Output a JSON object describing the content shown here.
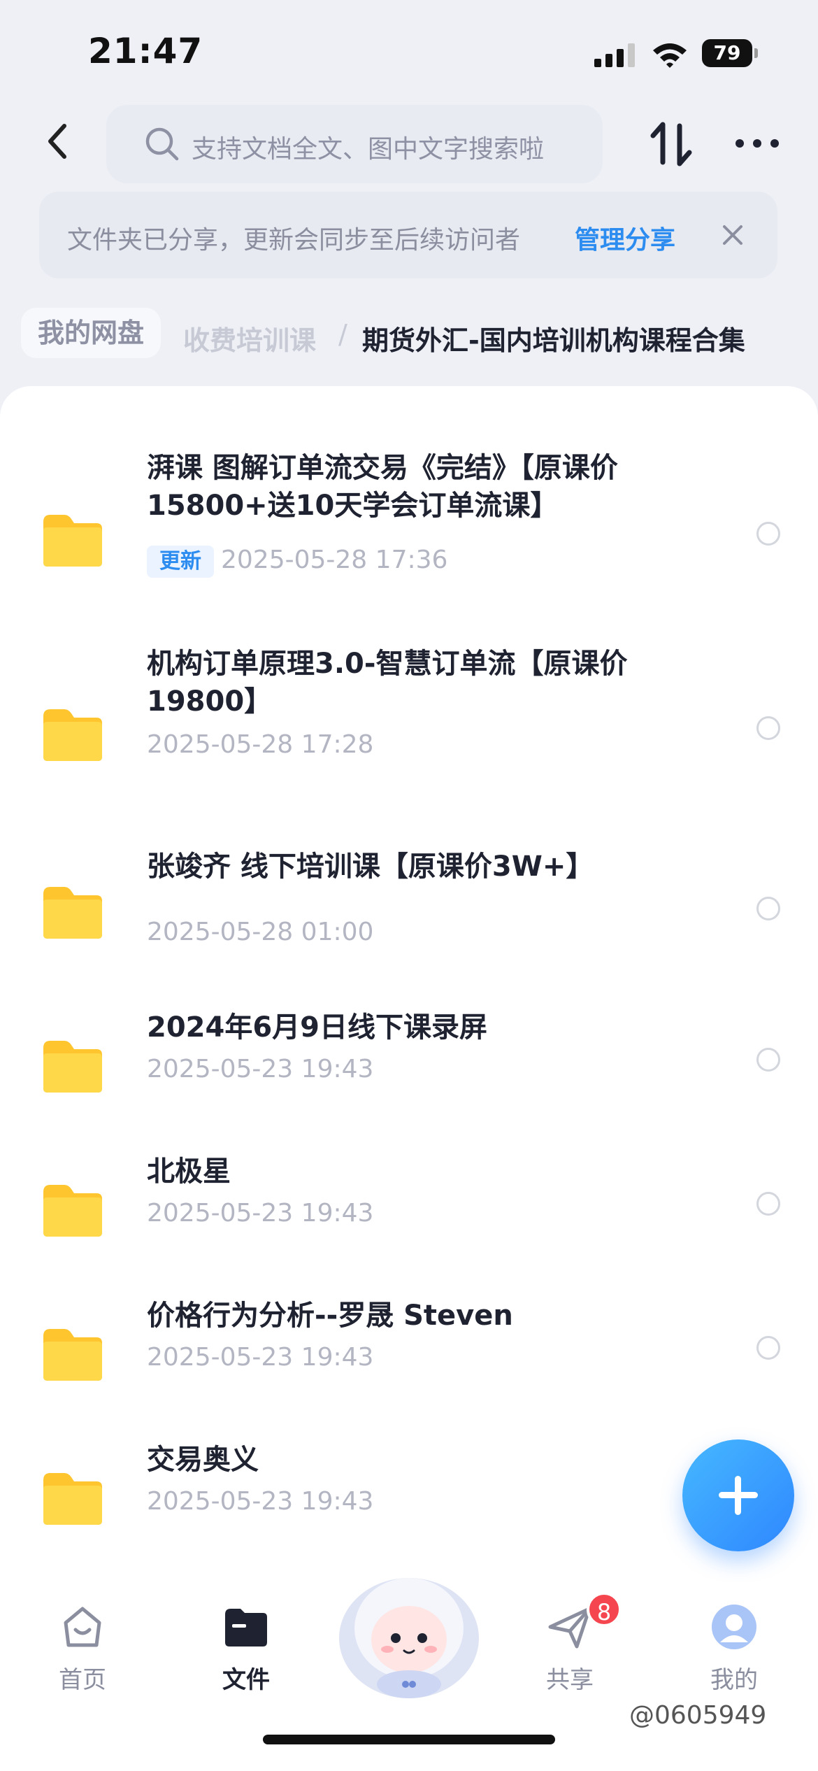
{
  "status_bar": {
    "time": "21:47",
    "battery": "79"
  },
  "header": {
    "search_placeholder": "支持文档全文、图中文字搜索啦"
  },
  "notice": {
    "text": "文件夹已分享，更新会同步至后续访问者",
    "link": "管理分享"
  },
  "breadcrumb": {
    "home": "我的网盘",
    "middle": "收费培训课",
    "separator": "/",
    "current": "期货外汇-国内培训机构课程合集"
  },
  "files": [
    {
      "title": "湃课 图解订单流交易《完结》【原课价15800+送10天学会订单流课】",
      "badge": "更新",
      "date": "2025-05-28 17:36"
    },
    {
      "title": "机构订单原理3.0-智慧订单流【原课价19800】",
      "date": "2025-05-28 17:28"
    },
    {
      "title": "张竣齐 线下培训课【原课价3W+】",
      "date": "2025-05-28 01:00"
    },
    {
      "title": "2024年6月9日线下课录屏",
      "date": "2025-05-23 19:43"
    },
    {
      "title": "北极星",
      "date": "2025-05-23 19:43"
    },
    {
      "title": "价格行为分析--罗晟 Steven",
      "date": "2025-05-23 19:43"
    },
    {
      "title": "交易奥义",
      "date": "2025-05-23 19:43"
    }
  ],
  "tabbar": {
    "home": "首页",
    "files": "文件",
    "share": "共享",
    "share_badge": "8",
    "me": "我的"
  },
  "watermark": "@0605949",
  "colors": {
    "accent": "#2d8cf0",
    "folder": "#ffcf3a",
    "badge_red": "#f5464f"
  }
}
